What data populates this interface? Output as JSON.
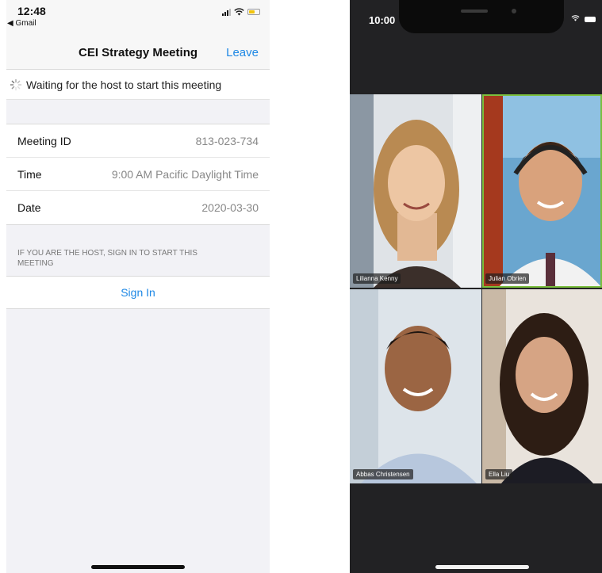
{
  "left": {
    "status": {
      "time": "12:48",
      "back_app": "◀ Gmail"
    },
    "nav": {
      "title": "CEI Strategy Meeting",
      "leave": "Leave"
    },
    "waiting": "Waiting for the host to start this meeting",
    "details": [
      {
        "label": "Meeting ID",
        "value": "813-023-734"
      },
      {
        "label": "Time",
        "value": "9:00 AM Pacific Daylight Time"
      },
      {
        "label": "Date",
        "value": "2020-03-30"
      }
    ],
    "host_note": "IF YOU ARE THE HOST, SIGN IN TO START THIS MEETING",
    "sign_in": "Sign In"
  },
  "right": {
    "status": {
      "time": "10:00"
    },
    "participants": [
      {
        "name": "Lilianna Kenny",
        "active": false
      },
      {
        "name": "Julian Obrien",
        "active": true
      },
      {
        "name": "Abbas Christensen",
        "active": false
      },
      {
        "name": "Ella Liu",
        "active": false
      }
    ]
  },
  "colors": {
    "accent": "#1e88e5",
    "active_speaker": "#7bbf3e"
  }
}
